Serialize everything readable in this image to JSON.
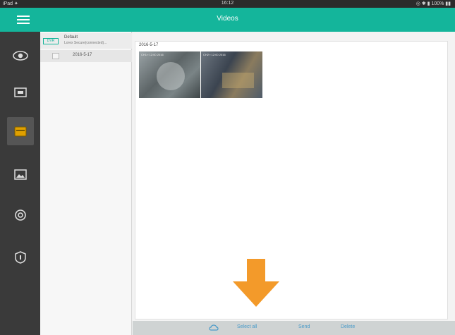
{
  "status_bar": {
    "left": "iPad ✦",
    "time": "16:12",
    "right": "◎ ✱ ▮ 100% ▮▮"
  },
  "app_bar": {
    "title": "Videos"
  },
  "sidebar": {
    "items": [
      {
        "icon": "eye-icon"
      },
      {
        "icon": "playback-icon"
      },
      {
        "icon": "videos-folder-icon",
        "active": true
      },
      {
        "icon": "photos-icon"
      },
      {
        "icon": "settings-icon"
      },
      {
        "icon": "info-icon"
      }
    ]
  },
  "tree": {
    "device_badge": "DVR",
    "device_name": "Default",
    "device_sub": "Lorex Secure(connected)...",
    "date_item": "2016-5-17"
  },
  "content": {
    "date_label": "2016-5-17",
    "thumbnails": [
      {
        "caption": "CH1 ▪ 12:00 2016"
      },
      {
        "caption": "CH2 ▪ 12:00 2016"
      }
    ]
  },
  "bottom_bar": {
    "links": [
      "Select all",
      "Send",
      "Delete"
    ]
  },
  "colors": {
    "accent": "#14b59b",
    "arrow": "#f39a2a",
    "link": "#4a9bc9"
  }
}
